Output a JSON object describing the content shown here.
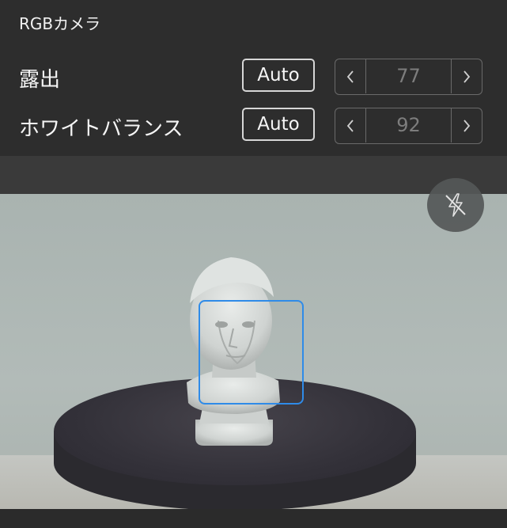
{
  "panel": {
    "title": "RGBカメラ",
    "rows": [
      {
        "label": "露出",
        "auto_label": "Auto",
        "value": "77"
      },
      {
        "label": "ホワイトバランス",
        "auto_label": "Auto",
        "value": "92"
      }
    ]
  },
  "icons": {
    "decrement": "chevron-left-icon",
    "increment": "chevron-right-icon",
    "flash": "flash-off-icon"
  },
  "colors": {
    "face_box": "#2f8be8",
    "value_text": "#7d7d7d"
  }
}
